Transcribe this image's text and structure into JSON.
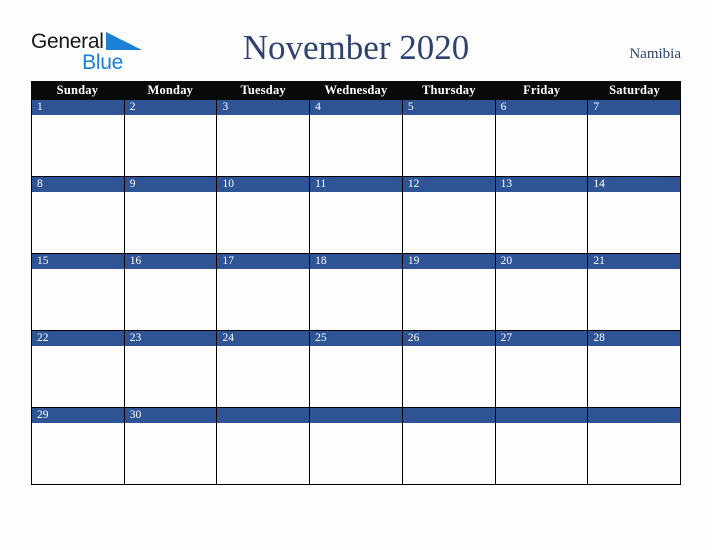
{
  "header": {
    "logo": {
      "text_top": "General",
      "text_bottom": "Blue",
      "triangle_color": "#1b7fd4",
      "top_color": "#17181a",
      "bottom_color": "#1b7fd4"
    },
    "month_title": "November 2020",
    "country": "Namibia",
    "title_color": "#2e4272"
  },
  "calendar": {
    "weekday_headers": [
      "Sunday",
      "Monday",
      "Tuesday",
      "Wednesday",
      "Thursday",
      "Friday",
      "Saturday"
    ],
    "header_bg": "#0a0a0a",
    "header_text_color": "#ffffff",
    "day_bar_color": "#2f5496",
    "day_text_color": "#ffffff",
    "cell_bg": "#fefefe",
    "border_color": "#000000",
    "weeks": [
      {
        "days": [
          {
            "number": "1"
          },
          {
            "number": "2"
          },
          {
            "number": "3"
          },
          {
            "number": "4"
          },
          {
            "number": "5"
          },
          {
            "number": "6"
          },
          {
            "number": "7"
          }
        ]
      },
      {
        "days": [
          {
            "number": "8"
          },
          {
            "number": "9"
          },
          {
            "number": "10"
          },
          {
            "number": "11"
          },
          {
            "number": "12"
          },
          {
            "number": "13"
          },
          {
            "number": "14"
          }
        ]
      },
      {
        "days": [
          {
            "number": "15"
          },
          {
            "number": "16"
          },
          {
            "number": "17"
          },
          {
            "number": "18"
          },
          {
            "number": "19"
          },
          {
            "number": "20"
          },
          {
            "number": "21"
          }
        ]
      },
      {
        "days": [
          {
            "number": "22"
          },
          {
            "number": "23"
          },
          {
            "number": "24"
          },
          {
            "number": "25"
          },
          {
            "number": "26"
          },
          {
            "number": "27"
          },
          {
            "number": "28"
          }
        ]
      },
      {
        "days": [
          {
            "number": "29"
          },
          {
            "number": "30"
          },
          {
            "number": ""
          },
          {
            "number": ""
          },
          {
            "number": ""
          },
          {
            "number": ""
          },
          {
            "number": ""
          }
        ]
      }
    ]
  }
}
